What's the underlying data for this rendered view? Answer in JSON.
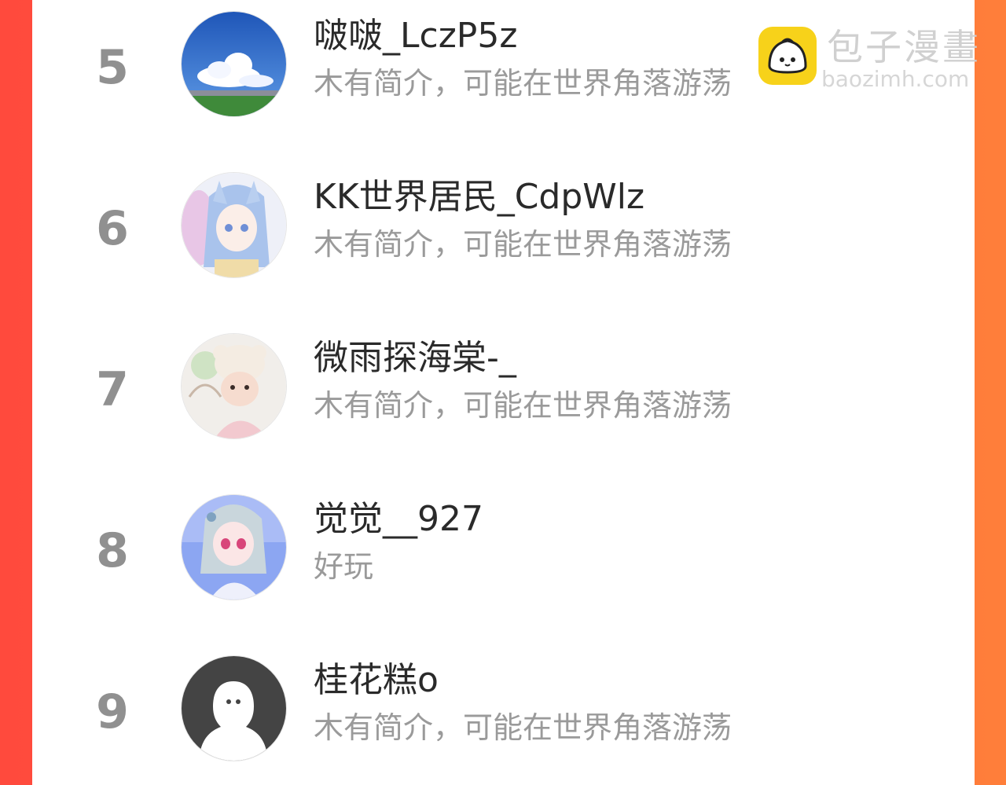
{
  "colors": {
    "gradient_left": "#ff4a3d",
    "gradient_right": "#ff7f3a",
    "panel": "#ffffff",
    "rank": "#909090",
    "name": "#2a2a2a",
    "bio": "#9a9a9a"
  },
  "ranking": [
    {
      "rank": "5",
      "name": "啵啵_LczP5z",
      "bio": "木有简介，可能在世界角落游荡",
      "avatar": "sky-clouds-avatar"
    },
    {
      "rank": "6",
      "name": "KK世界居民_CdpWlz",
      "bio": "木有简介，可能在世界角落游荡",
      "avatar": "anime-girl-blue-avatar"
    },
    {
      "rank": "7",
      "name": "微雨探海棠-_",
      "bio": "木有简介，可能在世界角落游荡",
      "avatar": "child-bear-hat-avatar"
    },
    {
      "rank": "8",
      "name": "觉觉__927",
      "bio": "好玩",
      "avatar": "anime-girl-purple-avatar"
    },
    {
      "rank": "9",
      "name": "桂花糕o",
      "bio": "木有简介，可能在世界角落游荡",
      "avatar": "default-ghost-avatar"
    }
  ],
  "watermark": {
    "title": "包子漫畫",
    "url": "baozimh.com",
    "logo_icon": "baozi-logo-icon"
  }
}
